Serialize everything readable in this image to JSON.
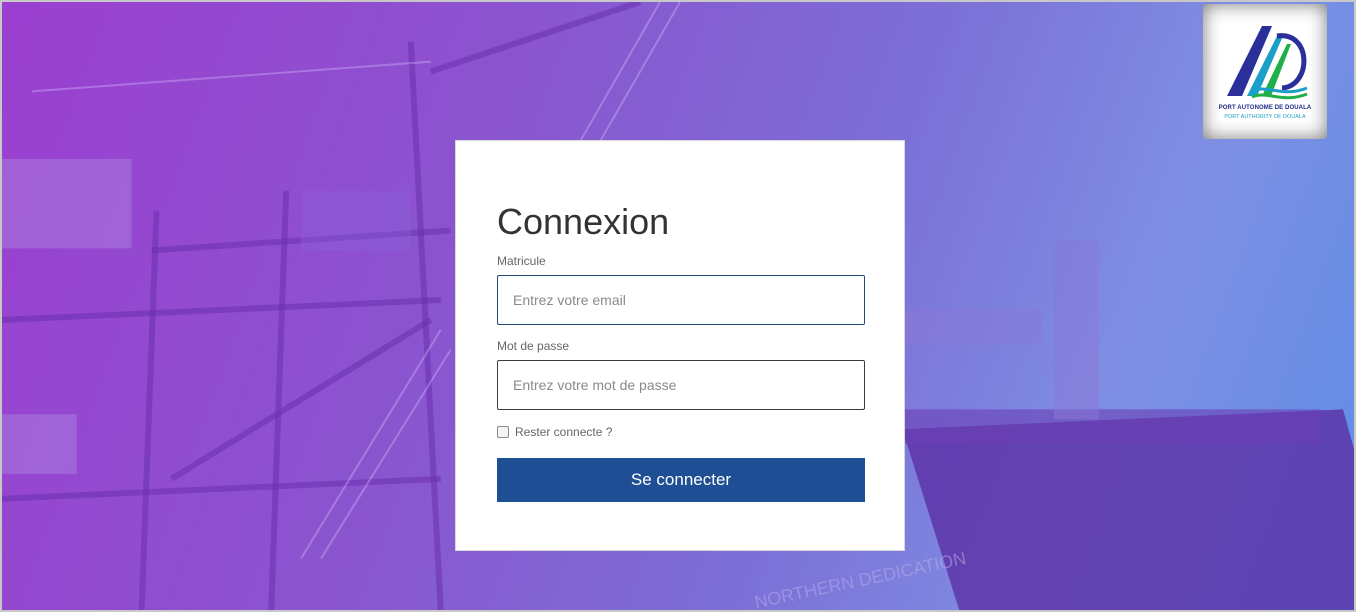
{
  "logo": {
    "name": "port-autonome-de-douala-logo",
    "line1": "PORT AUTONOME DE DOUALA",
    "line2": "PORT AUTHORITY OF DOUALA"
  },
  "login": {
    "title": "Connexion",
    "matricule_label": "Matricule",
    "matricule_placeholder": "Entrez votre email",
    "matricule_value": "",
    "password_label": "Mot de passe",
    "password_placeholder": "Entrez votre mot de passe",
    "password_value": "",
    "remember_label": "Rester connecte ?",
    "remember_checked": false,
    "submit_label": "Se connecter"
  },
  "background": {
    "ship_name": "NORTHERN DEDICATION"
  },
  "colors": {
    "accent": "#1e4e93",
    "background_left": "#9b3fd0",
    "background_right": "#5f8ee6"
  }
}
